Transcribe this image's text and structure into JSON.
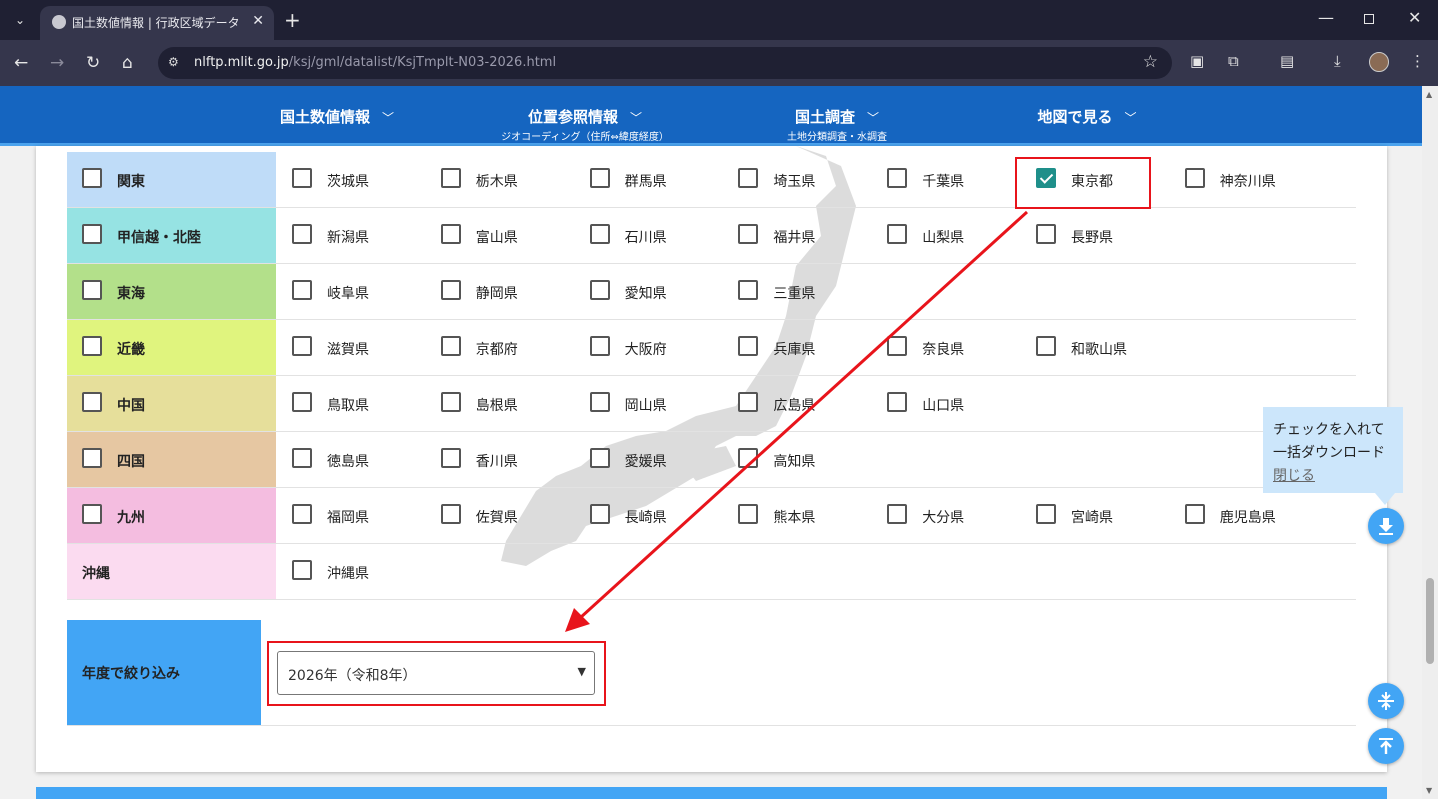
{
  "browser": {
    "tab_title": "国土数値情報 | 行政区域データ",
    "url_domain": "nlftp.mlit.go.jp",
    "url_path": "/ksj/gml/datalist/KsjTmplt-N03-2026.html"
  },
  "site_nav": {
    "items": [
      {
        "label": "国土数値情報",
        "sub": ""
      },
      {
        "label": "位置参照情報",
        "sub": "ジオコーディング（住所⇔緯度経度）"
      },
      {
        "label": "国土調査",
        "sub": "土地分類調査・水調査"
      },
      {
        "label": "地図で見る",
        "sub": ""
      }
    ],
    "chevron": "﹀"
  },
  "regions": [
    {
      "name": "関東",
      "color": "#bfdcf8",
      "checkbox": true,
      "prefs": [
        {
          "name": "茨城県",
          "checked": false
        },
        {
          "name": "栃木県",
          "checked": false
        },
        {
          "name": "群馬県",
          "checked": false
        },
        {
          "name": "埼玉県",
          "checked": false
        },
        {
          "name": "千葉県",
          "checked": false
        },
        {
          "name": "東京都",
          "checked": true
        },
        {
          "name": "神奈川県",
          "checked": false
        }
      ]
    },
    {
      "name": "甲信越・北陸",
      "color": "#96e3e3",
      "checkbox": true,
      "prefs": [
        {
          "name": "新潟県",
          "checked": false
        },
        {
          "name": "富山県",
          "checked": false
        },
        {
          "name": "石川県",
          "checked": false
        },
        {
          "name": "福井県",
          "checked": false
        },
        {
          "name": "山梨県",
          "checked": false
        },
        {
          "name": "長野県",
          "checked": false
        }
      ]
    },
    {
      "name": "東海",
      "color": "#b3e08a",
      "checkbox": true,
      "prefs": [
        {
          "name": "岐阜県",
          "checked": false
        },
        {
          "name": "静岡県",
          "checked": false
        },
        {
          "name": "愛知県",
          "checked": false
        },
        {
          "name": "三重県",
          "checked": false
        }
      ]
    },
    {
      "name": "近畿",
      "color": "#e0f47e",
      "checkbox": true,
      "prefs": [
        {
          "name": "滋賀県",
          "checked": false
        },
        {
          "name": "京都府",
          "checked": false
        },
        {
          "name": "大阪府",
          "checked": false
        },
        {
          "name": "兵庫県",
          "checked": false
        },
        {
          "name": "奈良県",
          "checked": false
        },
        {
          "name": "和歌山県",
          "checked": false
        }
      ]
    },
    {
      "name": "中国",
      "color": "#e6df9b",
      "checkbox": true,
      "prefs": [
        {
          "name": "鳥取県",
          "checked": false
        },
        {
          "name": "島根県",
          "checked": false
        },
        {
          "name": "岡山県",
          "checked": false
        },
        {
          "name": "広島県",
          "checked": false
        },
        {
          "name": "山口県",
          "checked": false
        }
      ]
    },
    {
      "name": "四国",
      "color": "#e6c7a2",
      "checkbox": true,
      "prefs": [
        {
          "name": "徳島県",
          "checked": false
        },
        {
          "name": "香川県",
          "checked": false
        },
        {
          "name": "愛媛県",
          "checked": false
        },
        {
          "name": "高知県",
          "checked": false
        }
      ]
    },
    {
      "name": "九州",
      "color": "#f4bde0",
      "checkbox": true,
      "prefs": [
        {
          "name": "福岡県",
          "checked": false
        },
        {
          "name": "佐賀県",
          "checked": false
        },
        {
          "name": "長崎県",
          "checked": false
        },
        {
          "name": "熊本県",
          "checked": false
        },
        {
          "name": "大分県",
          "checked": false
        },
        {
          "name": "宮崎県",
          "checked": false
        },
        {
          "name": "鹿児島県",
          "checked": false
        }
      ]
    },
    {
      "name": "沖縄",
      "color": "#fbdbf0",
      "checkbox": false,
      "prefs": [
        {
          "name": "沖縄県",
          "checked": false
        }
      ]
    }
  ],
  "year_filter": {
    "label": "年度で絞り込み",
    "selected": "2026年（令和8年）"
  },
  "tooltip": {
    "line1": "チェックを入れて",
    "line2": "一括ダウンロード",
    "close": "閉じる"
  },
  "icons": [
    "search-icon",
    "download-icon",
    "collapse-icon",
    "to-top-icon",
    "star-icon"
  ]
}
